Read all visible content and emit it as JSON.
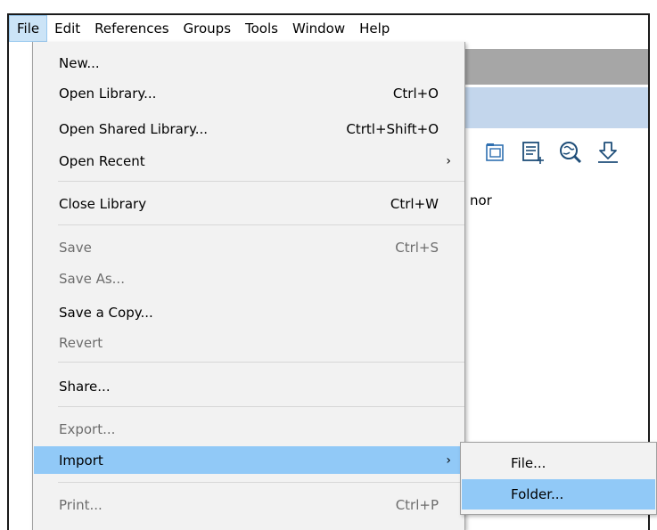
{
  "menubar": {
    "items": [
      {
        "label": "File",
        "active": true
      },
      {
        "label": "Edit"
      },
      {
        "label": "References"
      },
      {
        "label": "Groups"
      },
      {
        "label": "Tools"
      },
      {
        "label": "Window"
      },
      {
        "label": "Help"
      }
    ]
  },
  "background": {
    "partial_text": "nor",
    "toolbar_icons": [
      "new-group-icon",
      "new-reference-icon",
      "online-search-icon",
      "download-icon"
    ]
  },
  "file_menu": {
    "items": [
      {
        "label": "New...",
        "shortcut": "",
        "disabled": false
      },
      {
        "label": "Open Library...",
        "shortcut": "Ctrl+O",
        "disabled": false
      },
      {
        "label": "Open Shared Library...",
        "shortcut": "Ctrtl+Shift+O",
        "disabled": false
      },
      {
        "label": "Open Recent",
        "shortcut": "",
        "submenu": true,
        "disabled": false
      },
      {
        "label": "Close Library",
        "shortcut": "Ctrl+W",
        "disabled": false
      },
      {
        "label": "Save",
        "shortcut": "Ctrl+S",
        "disabled": true
      },
      {
        "label": "Save As...",
        "shortcut": "",
        "disabled": true
      },
      {
        "label": "Save a Copy...",
        "shortcut": "",
        "disabled": false
      },
      {
        "label": "Revert",
        "shortcut": "",
        "disabled": true
      },
      {
        "label": "Share...",
        "shortcut": "",
        "disabled": false
      },
      {
        "label": "Export...",
        "shortcut": "",
        "disabled": true
      },
      {
        "label": "Import",
        "shortcut": "",
        "submenu": true,
        "highlighted": true,
        "disabled": false
      },
      {
        "label": "Print...",
        "shortcut": "Ctrl+P",
        "disabled": true
      }
    ]
  },
  "import_submenu": {
    "items": [
      {
        "label": "File...",
        "highlighted": false
      },
      {
        "label": "Folder...",
        "highlighted": true
      }
    ]
  },
  "colors": {
    "highlight": "#91c9f7",
    "menu_bg": "#f2f2f2",
    "disabled_text": "#6d6d6d",
    "active_menu_bg": "#cce4f7"
  }
}
